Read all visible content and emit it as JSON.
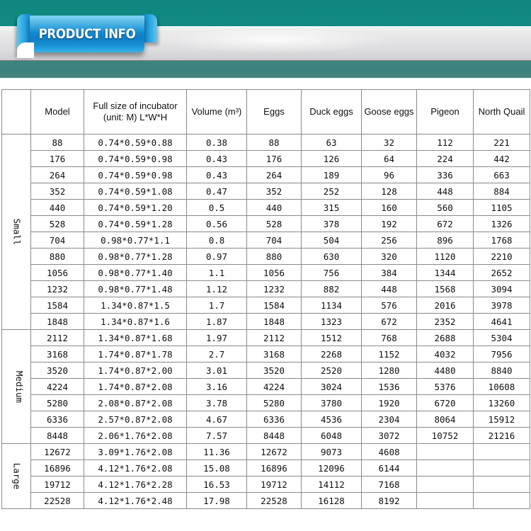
{
  "banner": {
    "title": "PRODUCT INFO",
    "teal_color": "#11867f",
    "teal_bottom_color": "#3d827d",
    "ribbon_color": "#1189cf",
    "bar_color": "#e2e2e4"
  },
  "table": {
    "headers": [
      "",
      "Model",
      {
        "line1": "Full size of incubator",
        "line2": "(unit: M)  L*W*H"
      },
      "Volume (m³)",
      "Eggs",
      "Duck eggs",
      "Goose eggs",
      "Pigeon",
      "North Quail"
    ],
    "groups": [
      {
        "label": "Small",
        "rows": [
          [
            "88",
            "0.74*0.59*0.88",
            "0.38",
            "88",
            "63",
            "32",
            "112",
            "221"
          ],
          [
            "176",
            "0.74*0.59*0.98",
            "0.43",
            "176",
            "126",
            "64",
            "224",
            "442"
          ],
          [
            "264",
            "0.74*0.59*0.98",
            "0.43",
            "264",
            "189",
            "96",
            "336",
            "663"
          ],
          [
            "352",
            "0.74*0.59*1.08",
            "0.47",
            "352",
            "252",
            "128",
            "448",
            "884"
          ],
          [
            "440",
            "0.74*0.59*1.20",
            "0.5",
            "440",
            "315",
            "160",
            "560",
            "1105"
          ],
          [
            "528",
            "0.74*0.59*1.28",
            "0.56",
            "528",
            "378",
            "192",
            "672",
            "1326"
          ],
          [
            "704",
            "0.98*0.77*1.1",
            "0.8",
            "704",
            "504",
            "256",
            "896",
            "1768"
          ],
          [
            "880",
            "0.98*0.77*1.28",
            "0.97",
            "880",
            "630",
            "320",
            "1120",
            "2210"
          ],
          [
            "1056",
            "0.98*0.77*1.40",
            "1.1",
            "1056",
            "756",
            "384",
            "1344",
            "2652"
          ],
          [
            "1232",
            "0.98*0.77*1.48",
            "1.12",
            "1232",
            "882",
            "448",
            "1568",
            "3094"
          ],
          [
            "1584",
            "1.34*0.87*1.5",
            "1.7",
            "1584",
            "1134",
            "576",
            "2016",
            "3978"
          ],
          [
            "1848",
            "1.34*0.87*1.6",
            "1.87",
            "1848",
            "1323",
            "672",
            "2352",
            "4641"
          ]
        ]
      },
      {
        "label": "Medium",
        "rows": [
          [
            "2112",
            "1.34*0.87*1.68",
            "1.97",
            "2112",
            "1512",
            "768",
            "2688",
            "5304"
          ],
          [
            "3168",
            "1.74*0.87*1.78",
            "2.7",
            "3168",
            "2268",
            "1152",
            "4032",
            "7956"
          ],
          [
            "3520",
            "1.74*0.87*2.00",
            "3.01",
            "3520",
            "2520",
            "1280",
            "4480",
            "8840"
          ],
          [
            "4224",
            "1.74*0.87*2.08",
            "3.16",
            "4224",
            "3024",
            "1536",
            "5376",
            "10608"
          ],
          [
            "5280",
            "2.08*0.87*2.08",
            "3.78",
            "5280",
            "3780",
            "1920",
            "6720",
            "13260"
          ],
          [
            "6336",
            "2.57*0.87*2.08",
            "4.67",
            "6336",
            "4536",
            "2304",
            "8064",
            "15912"
          ],
          [
            "8448",
            "2.06*1.76*2.08",
            "7.57",
            "8448",
            "6048",
            "3072",
            "10752",
            "21216"
          ]
        ]
      },
      {
        "label": "Large",
        "rows": [
          [
            "12672",
            "3.09*1.76*2.08",
            "11.36",
            "12672",
            "9073",
            "4608",
            "",
            ""
          ],
          [
            "16896",
            "4.12*1.76*2.08",
            "15.08",
            "16896",
            "12096",
            "6144",
            "",
            ""
          ],
          [
            "19712",
            "4.12*1.76*2.28",
            "16.53",
            "19712",
            "14112",
            "7168",
            "",
            ""
          ],
          [
            "22528",
            "4.12*1.76*2.48",
            "17.98",
            "22528",
            "16128",
            "8192",
            "",
            ""
          ]
        ]
      }
    ]
  }
}
